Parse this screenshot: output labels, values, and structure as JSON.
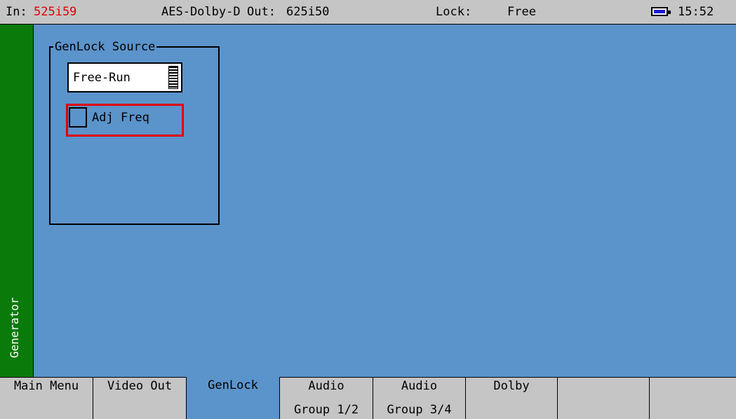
{
  "status_bar": {
    "in_label": "In:",
    "in_format": "525i59",
    "audio": "AES-Dolby-D",
    "out_label": "Out:",
    "out_format": "625i50",
    "lock_label": "Lock:",
    "lock_value": "Free",
    "time": "15:52",
    "battery_icon": "battery-icon"
  },
  "sidebar": {
    "label": "Generator"
  },
  "genlock_panel": {
    "title": "GenLock Source",
    "source_select": {
      "value": "Free-Run",
      "icon": "scroll-list-icon"
    },
    "adj_freq": {
      "label": "Adj Freq",
      "checked": false
    }
  },
  "tabs": [
    {
      "line1": "Main Menu",
      "line2": ""
    },
    {
      "line1": "Video Out",
      "line2": ""
    },
    {
      "line1": "GenLock",
      "line2": "",
      "active": true
    },
    {
      "line1": "Audio",
      "line2": "Group 1/2"
    },
    {
      "line1": "Audio",
      "line2": "Group 3/4"
    },
    {
      "line1": "Dolby",
      "line2": ""
    },
    {
      "line1": "",
      "line2": ""
    },
    {
      "line1": "",
      "line2": ""
    }
  ],
  "colors": {
    "background": "#5b93cb",
    "bar": "#c5c5c5",
    "sidebar": "#0a7a0a",
    "highlight": "#e00000"
  }
}
